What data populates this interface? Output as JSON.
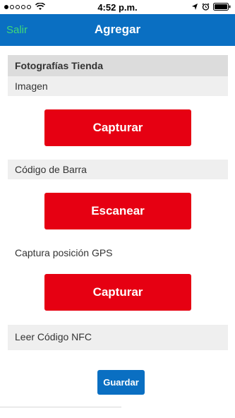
{
  "status_bar": {
    "time": "4:52 p.m.",
    "signal_dots": 5,
    "signal_filled": 1,
    "icons": [
      "wifi-icon",
      "location-arrow-icon",
      "alarm-icon",
      "battery-icon"
    ]
  },
  "nav": {
    "back_label": "Salir",
    "title": "Agregar"
  },
  "form": {
    "section_title": "Fotografías Tienda",
    "image_label": "Imagen",
    "capture_image_button": "Capturar",
    "barcode_label": "Código de Barra",
    "scan_button": "Escanear",
    "gps_label": "Captura posición GPS",
    "capture_gps_button": "Capturar",
    "nfc_label": "Leer Código NFC"
  },
  "footer": {
    "save_button": "Guardar"
  },
  "colors": {
    "nav_bg": "#0a6fc2",
    "back_text": "#3fd97a",
    "primary_button": "#e60012",
    "save_button": "#0a6fc2"
  }
}
